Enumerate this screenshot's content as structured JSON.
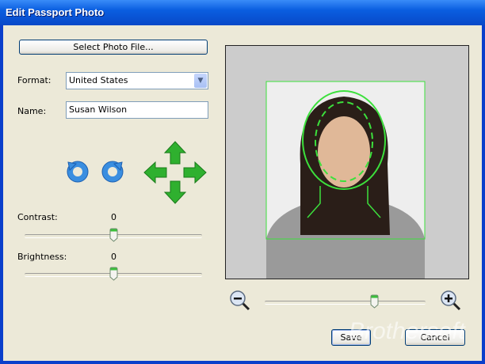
{
  "window": {
    "title": "Edit Passport Photo"
  },
  "left": {
    "select_photo_label": "Select Photo File...",
    "format_label": "Format:",
    "format_value": "United States",
    "name_label": "Name:",
    "name_value": "Susan Wilson",
    "contrast_label": "Contrast:",
    "contrast_value": "0",
    "brightness_label": "Brightness:",
    "brightness_value": "0"
  },
  "zoom": {
    "level_fraction": 0.68
  },
  "buttons": {
    "save": "Save",
    "cancel": "Cancel"
  },
  "watermark": "Brothersoft",
  "colors": {
    "guide": "#3CE03C",
    "titlebar": "#0A5EE0",
    "arrows": "#2FB02F",
    "rotate": "#3A8EE0"
  }
}
